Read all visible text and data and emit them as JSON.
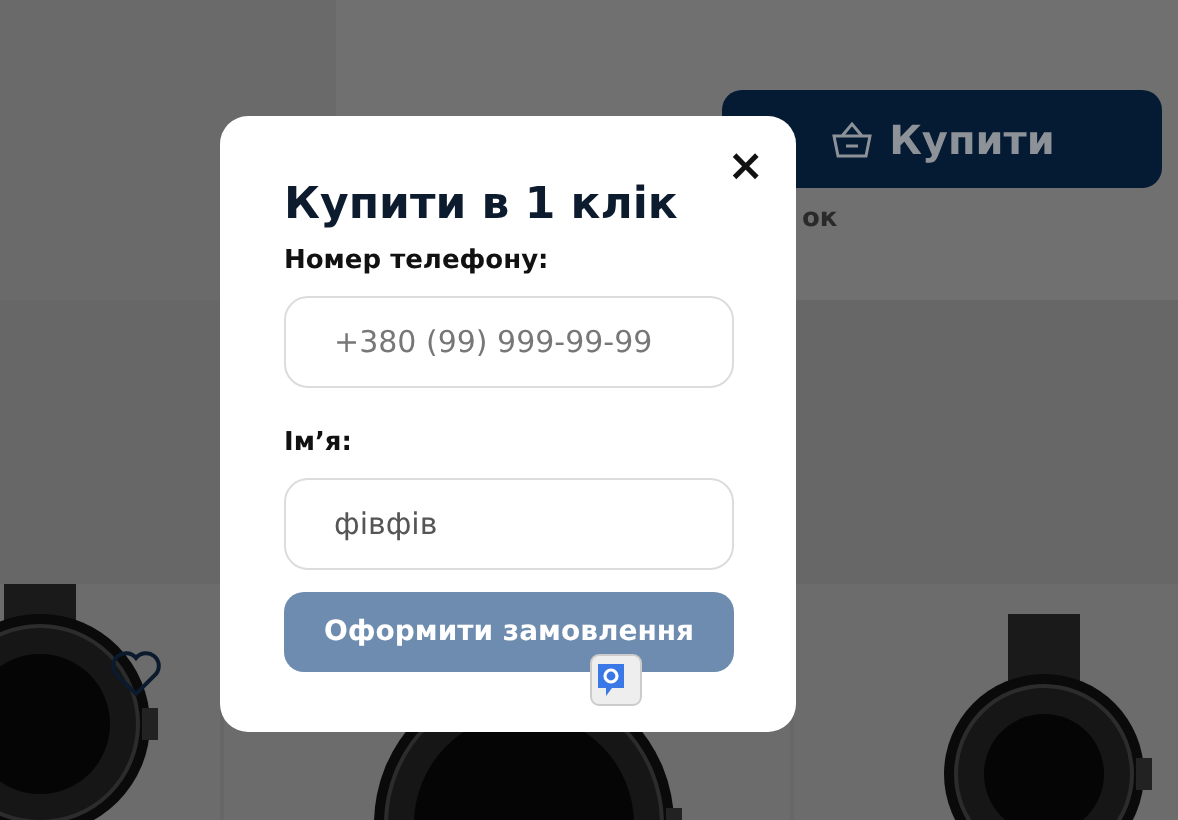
{
  "page": {
    "buy_button": "Купити",
    "note": "ок",
    "products": [
      {
        "kind": "picture",
        "favorite_icon": true
      },
      {
        "kind": "picture"
      },
      {
        "kind": "picture"
      }
    ]
  },
  "modal": {
    "title": "Купити в 1 клік",
    "close": "×",
    "fields": [
      {
        "label": "Номер телефону:",
        "placeholder": "+380 (99) 999-99-99"
      },
      {
        "label": "Ім’я:",
        "value": "фівфів"
      }
    ],
    "submit": "Оформити замовлення"
  }
}
